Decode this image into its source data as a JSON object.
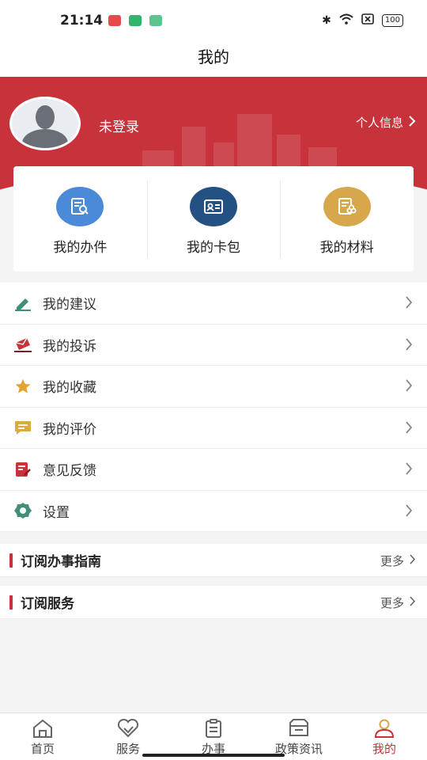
{
  "status_bar": {
    "time": "21:14",
    "battery": "100"
  },
  "nav": {
    "title": "我的"
  },
  "profile": {
    "login_status": "未登录",
    "info_link": "个人信息"
  },
  "quick_actions": [
    {
      "label": "我的办件",
      "icon": "search-document-icon",
      "color": "#4a8ad6"
    },
    {
      "label": "我的卡包",
      "icon": "id-card-icon",
      "color": "#245183"
    },
    {
      "label": "我的材料",
      "icon": "materials-icon",
      "color": "#d6a84b"
    }
  ],
  "menu": [
    {
      "label": "我的建议",
      "icon": "edit-pen-icon"
    },
    {
      "label": "我的投诉",
      "icon": "complaint-icon"
    },
    {
      "label": "我的收藏",
      "icon": "star-icon"
    },
    {
      "label": "我的评价",
      "icon": "comment-icon"
    },
    {
      "label": "意见反馈",
      "icon": "feedback-icon"
    },
    {
      "label": "设置",
      "icon": "gear-icon"
    }
  ],
  "subscriptions": [
    {
      "title": "订阅办事指南",
      "more": "更多"
    },
    {
      "title": "订阅服务",
      "more": "更多"
    }
  ],
  "tabs": [
    {
      "label": "首页",
      "icon": "home-icon"
    },
    {
      "label": "服务",
      "icon": "heart-tag-icon"
    },
    {
      "label": "办事",
      "icon": "clipboard-icon"
    },
    {
      "label": "政策资讯",
      "icon": "news-icon"
    },
    {
      "label": "我的",
      "icon": "user-icon",
      "active": true
    }
  ],
  "colors": {
    "brand_red": "#c8323b"
  }
}
